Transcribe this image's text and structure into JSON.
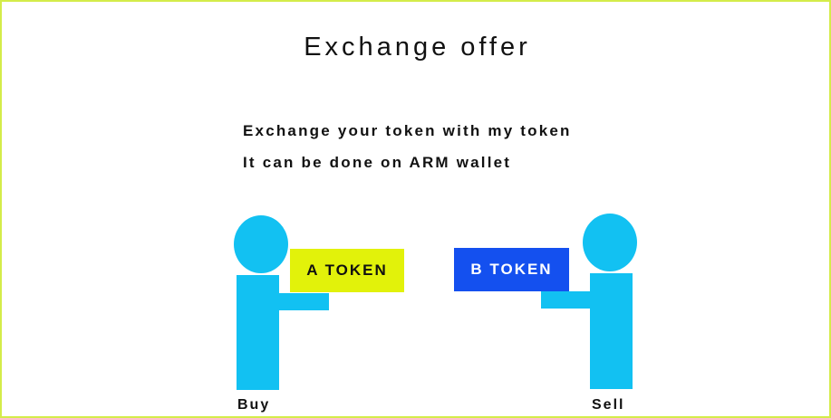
{
  "title": "Exchange offer",
  "description": {
    "line1": "Exchange your token with my token",
    "line2": "It can be done on ARM wallet"
  },
  "buyer": {
    "token_label": "A TOKEN",
    "caption": "Buy"
  },
  "seller": {
    "token_label": "B TOKEN",
    "caption": "Sell"
  },
  "colors": {
    "frame_border": "#d4ec4a",
    "person": "#12c1f2",
    "token_a_bg": "#e2f20a",
    "token_a_text": "#111111",
    "token_b_bg": "#1450ef",
    "token_b_text": "#ffffff"
  }
}
